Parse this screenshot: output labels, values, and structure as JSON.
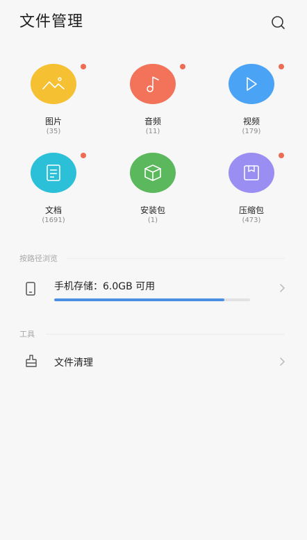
{
  "header": {
    "title": "文件管理",
    "search_icon": "search-icon"
  },
  "categories": [
    {
      "label": "图片",
      "count": "(35)",
      "color": "#f5c132",
      "icon": "image-icon",
      "new_dot": true
    },
    {
      "label": "音频",
      "count": "(11)",
      "color": "#f2735a",
      "icon": "music-note-icon",
      "new_dot": true
    },
    {
      "label": "视频",
      "count": "(179)",
      "color": "#4aa3f5",
      "icon": "play-icon",
      "new_dot": true
    },
    {
      "label": "文档",
      "count": "(1691)",
      "color": "#2cc0d8",
      "icon": "document-icon",
      "new_dot": true
    },
    {
      "label": "安装包",
      "count": "(1)",
      "color": "#5cb85c",
      "icon": "package-box-icon",
      "new_dot": false
    },
    {
      "label": "压缩包",
      "count": "(473)",
      "color": "#9b8ef2",
      "icon": "archive-icon",
      "new_dot": true
    }
  ],
  "badge_color": "#ee6b55",
  "browse": {
    "heading": "按路径浏览",
    "storage_label": "手机存储：6.0GB 可用",
    "storage_icon": "phone-icon",
    "used_fraction": 0.87,
    "progress_color": "#4a90e2"
  },
  "tools": {
    "heading": "工具",
    "items": [
      {
        "label": "文件清理",
        "icon": "broom-clean-icon"
      }
    ]
  }
}
